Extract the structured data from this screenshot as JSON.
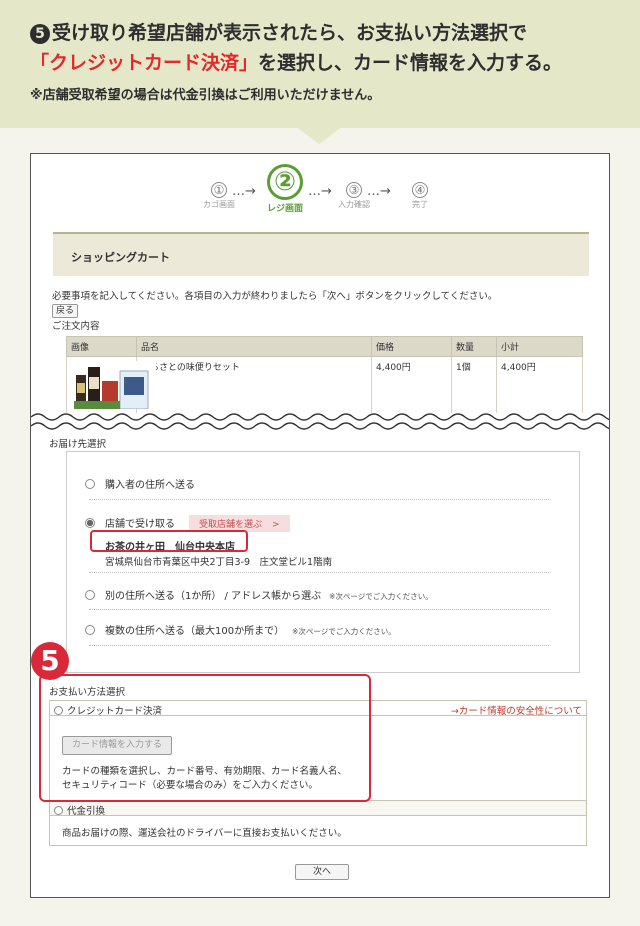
{
  "banner": {
    "number": "5",
    "line1": "受け取り希望店舗が表示されたら、お支払い方法選択で",
    "line2_q_open": "「",
    "line2_red": "クレジットカード決済",
    "line2_q_close": "」",
    "line2_rest": "を選択し、カード情報を入力する。",
    "line3": "※店舗受取希望の場合は代金引換はご利用いただけません。"
  },
  "steps": [
    {
      "num": "①",
      "label": "カゴ画面"
    },
    {
      "num": "②",
      "label": "レジ画面"
    },
    {
      "num": "③",
      "label": "入力確認"
    },
    {
      "num": "④",
      "label": "完了"
    }
  ],
  "step_arrow": "…→",
  "cart": {
    "title": "ショッピングカート",
    "instruction": "必要事項を記入してください。各項目の入力が終わりましたら「次へ」ボタンをクリックしてください。",
    "back_button": "戻る",
    "order_label": "ご注文内容",
    "columns": [
      "画像",
      "品名",
      "価格",
      "数量",
      "小計"
    ],
    "item": {
      "name": "ふるさとの味便りセット",
      "price": "4,400円",
      "qty": "1個",
      "subtotal": "4,400円"
    }
  },
  "shipping": {
    "label": "お届け先選択",
    "opt1": "購入者の住所へ送る",
    "opt2": "店舗で受け取る",
    "store_button": "受取店舗を選ぶ",
    "store_chevron": ">",
    "store_name": "お茶の井ヶ田　仙台中央本店",
    "store_address": "宮城県仙台市青葉区中央2丁目3-9　庄文堂ビル1階南",
    "opt3": "別の住所へ送る（1か所） / アドレス帳から選ぶ",
    "opt3_note": "※次ページでご入力ください。",
    "opt4": "複数の住所へ送る（最大100か所まで）",
    "opt4_note": "※次ページでご入力ください。"
  },
  "callout_number": "5",
  "payment": {
    "label": "お支払い方法選択",
    "credit": "クレジットカード決済",
    "security_link": "→カード情報の安全性について",
    "card_button": "カード情報を入力する",
    "card_desc1": "カードの種類を選択し、カード番号、有効期限、カード名義人名、",
    "card_desc2": "セキュリティコード（必要な場合のみ）をご入力ください。",
    "cod": "代金引換",
    "cod_desc": "商品お届けの際、運送会社のドライバーに直接お支払いください。"
  },
  "next_button": "次へ",
  "colors": {
    "accent_green": "#5a9e33",
    "highlight_red": "#d9283a",
    "banner_bg": "#e4e8c9"
  }
}
